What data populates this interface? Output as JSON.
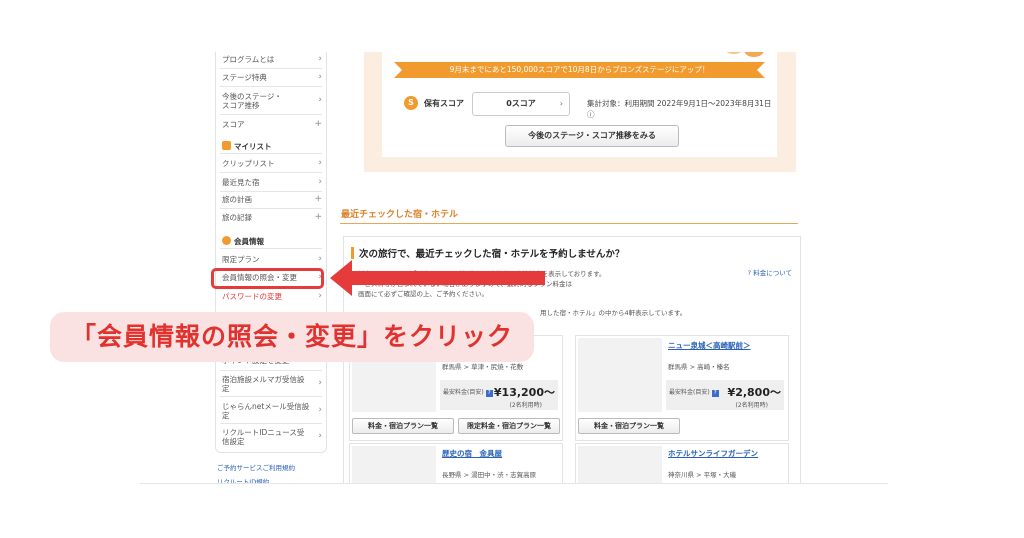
{
  "sidebar": {
    "program": "プログラムとは",
    "stage_benefit": "ステージ特典",
    "stage_trend_1": "今後のステージ・",
    "stage_trend_2": "スコア推移",
    "score": "スコア",
    "mylist_heading": "マイリスト",
    "clip_list": "クリップリスト",
    "recent": "最近見た宿",
    "travel_plan": "旅の計画",
    "travel_log": "旅の記録",
    "member_heading": "会員情報",
    "limited_plan": "限定プラン",
    "member_info": "会員情報の照会・変更",
    "password": "パスワードの変更",
    "hidden_item": "ポイント設定を変更",
    "inn_mail_1": "宿泊施設メルマガ受信設",
    "inn_mail_2": "定",
    "jalan_mail_1": "じゃらんnetメール受信設",
    "jalan_mail_2": "定",
    "recruit_news_1": "リクルートIDニュース受",
    "recruit_news_2": "信設定",
    "link_terms": "ご予約サービスご利用規約",
    "link_recruit": "リクルートID規約"
  },
  "score_panel": {
    "ribbon": "9月末までにあと150,000スコアで10月8日からブロンズステージにアップ！",
    "s_icon": "S",
    "label": "保有スコア",
    "value": "0スコア",
    "period": "集計対象：利用期間  2022年9月1日〜2023年8月31日",
    "trend_button": "今後のステージ・スコア推移をみる"
  },
  "recent": {
    "section_title": "最近チェックした宿・ホテル",
    "panel_title": "次の旅行で、最近チェックした宿・ホテルを予約しませんか？",
    "note1": "料金は、あくまで「目安」として1泊1部屋の人数分の合計料金を表示しております。",
    "note2": "ービス料等が含まれていない場合がありますので、最終的なプラン料金は",
    "note3": "画面にて必ずご確認の上、ご予約ください。",
    "note4": "用した宿・ホテル」の中から4軒表示しています。",
    "help_link": "料金について"
  },
  "hotels": [
    {
      "name": "",
      "area": "群馬県 > 草津・尻焼・花敷",
      "price_label": "最安料金(目安)",
      "price": "¥13,200〜",
      "price_sub": "(2名利用時)"
    },
    {
      "name": "ニュー泉城＜高崎駅前＞",
      "area": "群馬県 > 高崎・榛名",
      "price_label": "最安料金(目安)",
      "price": "¥2,800〜",
      "price_sub": "(2名利用時)"
    },
    {
      "name": "歴史の宿　金具屋",
      "area": "長野県 > 湯田中・渋・志賀高原"
    },
    {
      "name": "ホテルサンライフガーデン",
      "area": "神奈川県 > 平塚・大磯"
    }
  ],
  "buttons": {
    "plan_list": "料金・宿泊プラン一覧",
    "limited_plan_list": "限定料金・宿泊プラン一覧"
  },
  "callout": "「会員情報の照会・変更」をクリック",
  "colors": {
    "accent": "#f19a2d",
    "callout_text": "#e0322f",
    "callout_bg": "#fbe2e2",
    "link": "#2a62b8"
  }
}
